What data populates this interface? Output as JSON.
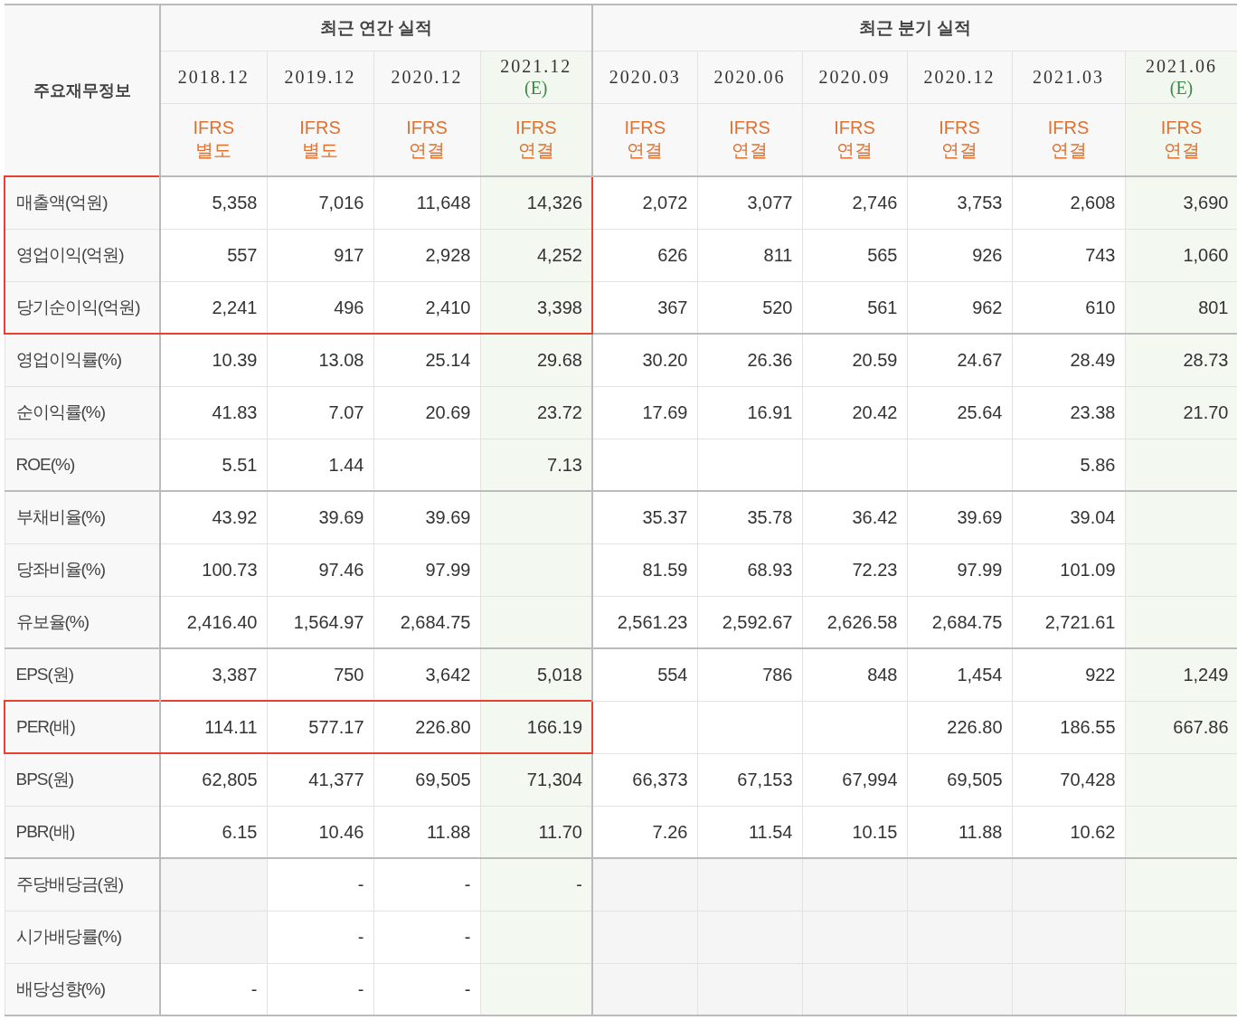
{
  "table": {
    "corner": "주요재무정보",
    "sections": [
      {
        "title": "최근 연간 실적",
        "columns": [
          {
            "period": "2018.12",
            "basis": [
              "IFRS",
              "별도"
            ]
          },
          {
            "period": "2019.12",
            "basis": [
              "IFRS",
              "별도"
            ]
          },
          {
            "period": "2020.12",
            "basis": [
              "IFRS",
              "연결"
            ]
          },
          {
            "period": "2021.12",
            "estimate_mark": "(E)",
            "basis": [
              "IFRS",
              "연결"
            ]
          }
        ]
      },
      {
        "title": "최근 분기 실적",
        "columns": [
          {
            "period": "2020.03",
            "basis": [
              "IFRS",
              "연결"
            ]
          },
          {
            "period": "2020.06",
            "basis": [
              "IFRS",
              "연결"
            ]
          },
          {
            "period": "2020.09",
            "basis": [
              "IFRS",
              "연결"
            ]
          },
          {
            "period": "2020.12",
            "basis": [
              "IFRS",
              "연결"
            ]
          },
          {
            "period": "2021.03",
            "basis": [
              "IFRS",
              "연결"
            ]
          },
          {
            "period": "2021.06",
            "estimate_mark": "(E)",
            "basis": [
              "IFRS",
              "연결"
            ]
          }
        ]
      }
    ],
    "groups": [
      {
        "kind": "normal",
        "rows": [
          {
            "label": "매출액(억원)",
            "highlighted": true,
            "cells": [
              {
                "value": "5,358"
              },
              {
                "value": "7,016"
              },
              {
                "value": "11,648"
              },
              {
                "value": "14,326"
              },
              {
                "value": "2,072"
              },
              {
                "value": "3,077"
              },
              {
                "value": "2,746"
              },
              {
                "value": "3,753"
              },
              {
                "value": "2,608"
              },
              {
                "value": "3,690"
              }
            ]
          },
          {
            "label": "영업이익(억원)",
            "highlighted": true,
            "cells": [
              {
                "value": "557"
              },
              {
                "value": "917"
              },
              {
                "value": "2,928"
              },
              {
                "value": "4,252"
              },
              {
                "value": "626"
              },
              {
                "value": "811"
              },
              {
                "value": "565"
              },
              {
                "value": "926"
              },
              {
                "value": "743"
              },
              {
                "value": "1,060"
              }
            ]
          },
          {
            "label": "당기순이익(억원)",
            "highlighted": true,
            "cells": [
              {
                "value": "2,241"
              },
              {
                "value": "496"
              },
              {
                "value": "2,410"
              },
              {
                "value": "3,398"
              },
              {
                "value": "367"
              },
              {
                "value": "520"
              },
              {
                "value": "561"
              },
              {
                "value": "962"
              },
              {
                "value": "610"
              },
              {
                "value": "801"
              }
            ]
          }
        ]
      },
      {
        "kind": "normal",
        "rows": [
          {
            "label": "영업이익률(%)",
            "highlighted": false,
            "cells": [
              {
                "value": "10.39"
              },
              {
                "value": "13.08"
              },
              {
                "value": "25.14"
              },
              {
                "value": "29.68"
              },
              {
                "value": "30.20"
              },
              {
                "value": "26.36"
              },
              {
                "value": "20.59"
              },
              {
                "value": "24.67"
              },
              {
                "value": "28.49"
              },
              {
                "value": "28.73"
              }
            ]
          },
          {
            "label": "순이익률(%)",
            "highlighted": false,
            "cells": [
              {
                "value": "41.83"
              },
              {
                "value": "7.07"
              },
              {
                "value": "20.69"
              },
              {
                "value": "23.72"
              },
              {
                "value": "17.69"
              },
              {
                "value": "16.91"
              },
              {
                "value": "20.42"
              },
              {
                "value": "25.64"
              },
              {
                "value": "23.38"
              },
              {
                "value": "21.70"
              }
            ]
          },
          {
            "label": "ROE(%)",
            "highlighted": false,
            "cells": [
              {
                "value": "5.51"
              },
              {
                "value": "1.44"
              },
              {},
              {
                "value": "7.13"
              },
              {},
              {},
              {},
              {},
              {
                "value": "5.86"
              },
              {}
            ]
          }
        ]
      },
      {
        "kind": "normal",
        "rows": [
          {
            "label": "부채비율(%)",
            "highlighted": false,
            "cells": [
              {
                "value": "43.92"
              },
              {
                "value": "39.69"
              },
              {
                "value": "39.69"
              },
              {},
              {
                "value": "35.37"
              },
              {
                "value": "35.78"
              },
              {
                "value": "36.42"
              },
              {
                "value": "39.69"
              },
              {
                "value": "39.04"
              },
              {}
            ]
          },
          {
            "label": "당좌비율(%)",
            "highlighted": false,
            "cells": [
              {
                "value": "100.73"
              },
              {
                "value": "97.46"
              },
              {
                "value": "97.99"
              },
              {},
              {
                "value": "81.59"
              },
              {
                "value": "68.93"
              },
              {
                "value": "72.23"
              },
              {
                "value": "97.99"
              },
              {
                "value": "101.09"
              },
              {}
            ]
          },
          {
            "label": "유보율(%)",
            "highlighted": false,
            "cells": [
              {
                "value": "2,416.40"
              },
              {
                "value": "1,564.97"
              },
              {
                "value": "2,684.75"
              },
              {},
              {
                "value": "2,561.23"
              },
              {
                "value": "2,592.67"
              },
              {
                "value": "2,626.58"
              },
              {
                "value": "2,684.75"
              },
              {
                "value": "2,721.61"
              },
              {}
            ]
          }
        ]
      },
      {
        "kind": "normal",
        "rows": [
          {
            "label": "EPS(원)",
            "highlighted": false,
            "cells": [
              {
                "value": "3,387"
              },
              {
                "value": "750"
              },
              {
                "value": "3,642"
              },
              {
                "value": "5,018"
              },
              {
                "value": "554"
              },
              {
                "value": "786"
              },
              {
                "value": "848"
              },
              {
                "value": "1,454"
              },
              {
                "value": "922"
              },
              {
                "value": "1,249"
              }
            ]
          },
          {
            "label": "PER(배)",
            "highlighted": true,
            "cells": [
              {
                "value": "114.11"
              },
              {
                "value": "577.17"
              },
              {
                "value": "226.80"
              },
              {
                "value": "166.19"
              },
              {},
              {},
              {},
              {
                "value": "226.80"
              },
              {
                "value": "186.55"
              },
              {
                "value": "667.86"
              }
            ]
          },
          {
            "label": "BPS(원)",
            "highlighted": false,
            "cells": [
              {
                "value": "62,805"
              },
              {
                "value": "41,377"
              },
              {
                "value": "69,505"
              },
              {
                "value": "71,304"
              },
              {
                "value": "66,373"
              },
              {
                "value": "67,153"
              },
              {
                "value": "67,994"
              },
              {
                "value": "69,505"
              },
              {
                "value": "70,428"
              },
              {}
            ]
          },
          {
            "label": "PBR(배)",
            "highlighted": false,
            "cells": [
              {
                "value": "6.15"
              },
              {
                "value": "10.46"
              },
              {
                "value": "11.88"
              },
              {
                "value": "11.70"
              },
              {
                "value": "7.26"
              },
              {
                "value": "11.54"
              },
              {
                "value": "10.15"
              },
              {
                "value": "11.88"
              },
              {
                "value": "10.62"
              },
              {}
            ]
          }
        ]
      },
      {
        "kind": "dividend",
        "rows": [
          {
            "label": "주당배당금(원)",
            "highlighted": false,
            "cells": [
              {},
              {
                "value": "-"
              },
              {
                "value": "-"
              },
              {
                "value": "-"
              },
              {},
              {},
              {},
              {},
              {},
              {}
            ]
          },
          {
            "label": "시가배당률(%)",
            "highlighted": false,
            "cells": [
              {},
              {
                "value": "-"
              },
              {
                "value": "-"
              },
              {},
              {},
              {},
              {},
              {},
              {},
              {}
            ]
          },
          {
            "label": "배당성향(%)",
            "highlighted": false,
            "cells": [
              {
                "value": "-"
              },
              {
                "value": "-"
              },
              {
                "value": "-"
              },
              {},
              {},
              {},
              {},
              {},
              {},
              {}
            ]
          }
        ]
      }
    ]
  }
}
